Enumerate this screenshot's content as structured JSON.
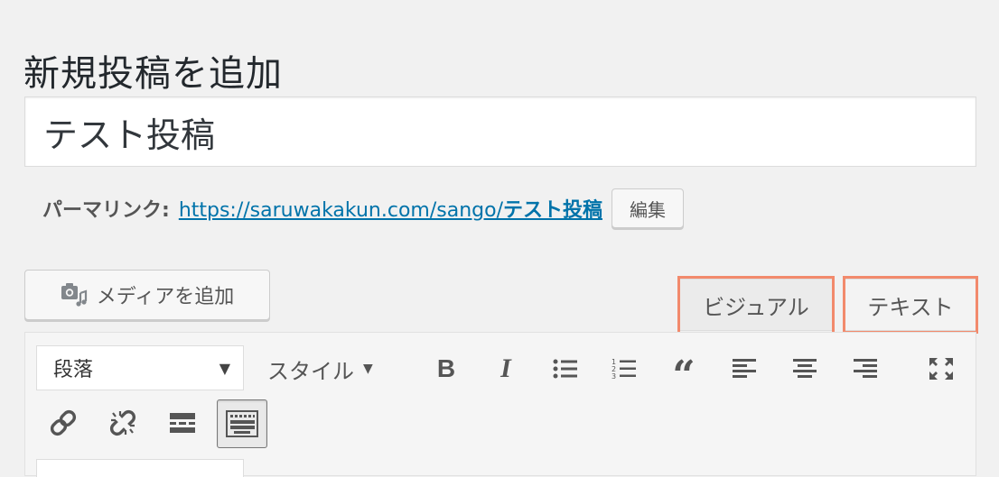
{
  "page_title": "新規投稿を追加",
  "post_title": {
    "value": "テスト投稿",
    "placeholder": ""
  },
  "permalink": {
    "label": "パーマリンク:",
    "url_base": "https://saruwakakun.com/sango/",
    "url_slug": "テスト投稿",
    "edit_label": "編集"
  },
  "media_button": {
    "label": "メディアを追加",
    "icon": "media-camera-icon"
  },
  "editor_tabs": [
    {
      "label": "ビジュアル",
      "highlighted": true
    },
    {
      "label": "テキスト",
      "highlighted": true
    }
  ],
  "toolbar": {
    "format_select": {
      "selected": "段落"
    },
    "style_dropdown": {
      "label": "スタイル"
    },
    "row1_icons": [
      "bold-icon",
      "italic-icon",
      "bulleted-list-icon",
      "numbered-list-icon",
      "blockquote-icon",
      "align-left-icon",
      "align-center-icon",
      "align-right-icon",
      "fullscreen-icon"
    ],
    "row2_icons": [
      "link-icon",
      "unlink-icon",
      "read-more-icon",
      "toolbar-toggle-icon"
    ]
  },
  "colors": {
    "highlight": "#f28a6c",
    "link": "#0073aa",
    "background": "#f1f1f1"
  }
}
